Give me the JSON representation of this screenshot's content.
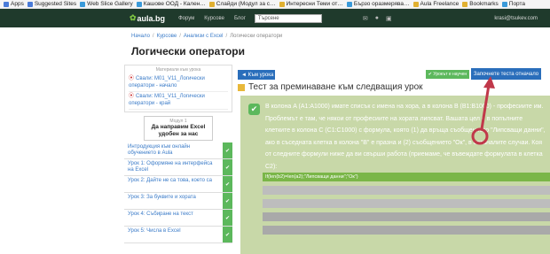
{
  "bookmarks": [
    {
      "label": "Apps",
      "color": "#4a7bd8"
    },
    {
      "label": "Suggested Sites",
      "color": "#4a7bd8"
    },
    {
      "label": "Web Slice Gallery",
      "color": "#3a9ad9"
    },
    {
      "label": "Кашове ООД - Кален…",
      "color": "#3a9ad9"
    },
    {
      "label": "Слайди (Модул за с…",
      "color": "#e0b030"
    },
    {
      "label": "Интересни Теми от…",
      "color": "#e0b030"
    },
    {
      "label": "Бързо оразмерява…",
      "color": "#3a9ad9"
    },
    {
      "label": "Aula Freelance",
      "color": "#e0b030"
    },
    {
      "label": "Bookmarks",
      "color": "#e0b030"
    },
    {
      "label": "Порта",
      "color": "#3a9ad9"
    }
  ],
  "site": {
    "logo": "aula.bg",
    "nav": [
      "Форум",
      "Курсове",
      "Блог"
    ],
    "search_placeholder": "Търсене",
    "user": "krasi@tsukev.com"
  },
  "breadcrumb": [
    "Начало",
    "Курсове",
    "Анализи с Excel",
    "Логически оператори"
  ],
  "page_title": "Логически оператори",
  "downloads": {
    "title": "Материали към урока",
    "items": [
      "Свали: M01_V11_Логически оператори - начало",
      "Свали: M01_V11_Логически оператори - край"
    ]
  },
  "module": {
    "number": "Модул 1",
    "name": "Да направим Excel удобен за нас"
  },
  "lessons": [
    "Интродукция към онлайн обучението в Aula",
    "Урок 1: Оформяне на интерфейса на Excel",
    "Урок 2: Дайте не са това, което са",
    "Урок 3: За буквите и хората",
    "Урок 4: Събиране на текст",
    "Урок 5: Числа в Excel"
  ],
  "buttons": {
    "back": "◄ Към урока",
    "ready": "✔ Урокът е научен",
    "start": "Започнете теста отначало"
  },
  "test": {
    "title": "Тест за преминаване към следващия урок",
    "question": "В колона A (A1:A1000) имате списък с имена на хора, а в колона B (B1:B1000) - професиите им. Проблемът е там, че някои от професиите на хората липсват. Вашата цел е в попълните клетките в колона C (C1:C1000) с формула, която (1) да връща съобщението \"Липсващи данни\", ако в съседната клетка в колона \"B\" е празна и (2) съобщението \"Ок\", в останалите случаи. Коя от следните формули ниже да ви свърши работа (приемаме, че въвеждате формулата в клетка C2):",
    "answers": [
      "If(len(b2)=len(a2);\"Липсващи данни\";\"Ок\")",
      "",
      "",
      "",
      ""
    ]
  },
  "colors": {
    "header_bg": "#1f3a2c",
    "accent_blue": "#2a6ebb",
    "accent_green": "#5cb85c",
    "question_bg": "#c8d8a8",
    "annotation": "#c0384a"
  }
}
